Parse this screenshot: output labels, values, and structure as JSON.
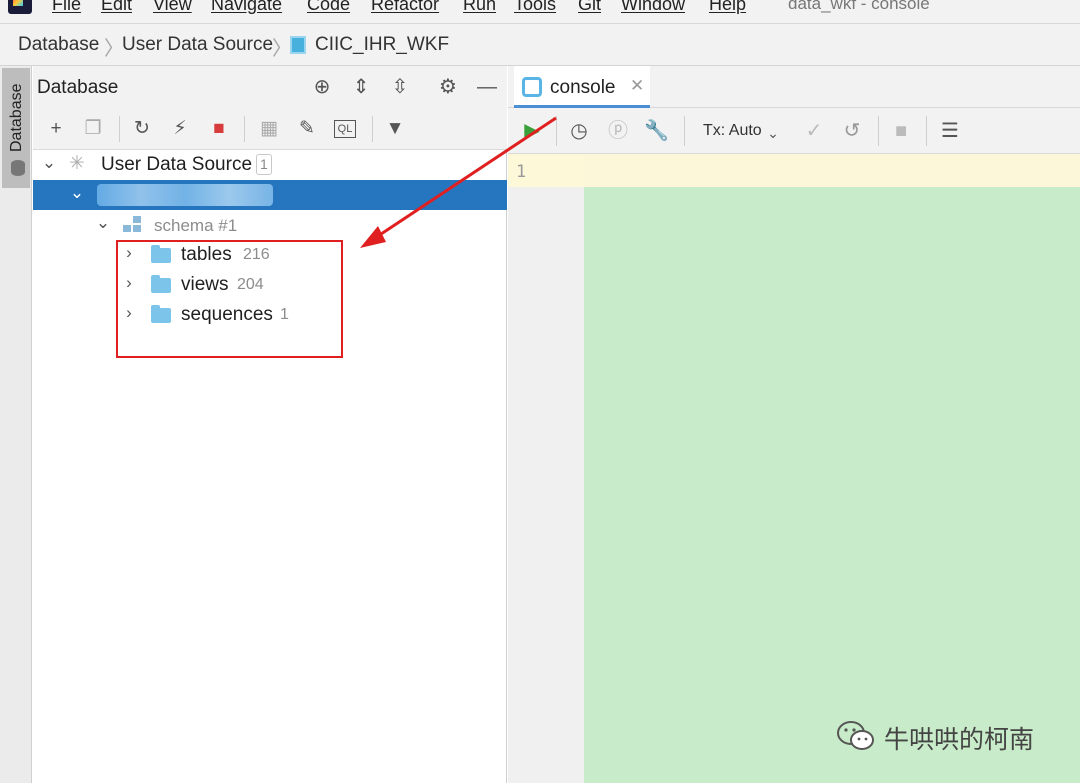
{
  "menu": {
    "items": [
      "File",
      "Edit",
      "View",
      "Navigate",
      "Code",
      "Refactor",
      "Run",
      "Tools",
      "Git",
      "Window",
      "Help"
    ],
    "window_title": "data_wkf - console"
  },
  "breadcrumb": {
    "items": [
      "Database",
      "User Data Source",
      "CIIC_IHR_WKF"
    ]
  },
  "side_stripe": {
    "label": "Database"
  },
  "db_panel": {
    "title": "Database",
    "header_icons": [
      "locate-icon",
      "expand-all-icon",
      "collapse-all-icon",
      "gear-icon",
      "minimize-icon"
    ],
    "toolbar_icons": [
      "add-icon",
      "duplicate-icon",
      "refresh-icon",
      "schema-sync-icon",
      "stop-icon",
      "table-view-icon",
      "edit-icon",
      "ql-console-icon",
      "filter-icon"
    ]
  },
  "tree": {
    "root": {
      "label": "User Data Source",
      "badge": "1"
    },
    "schema": {
      "label": "schema #1"
    },
    "folders": [
      {
        "label": "tables",
        "count": "216"
      },
      {
        "label": "views",
        "count": "204"
      },
      {
        "label": "sequences",
        "count": "1"
      }
    ]
  },
  "console": {
    "tab_label": "console",
    "tx_mode": "Tx: Auto",
    "line_number": "1",
    "toolbar_icons": [
      "run-icon",
      "history-icon",
      "parameters-icon",
      "settings-wrench-icon",
      "commit-icon",
      "rollback-icon",
      "stop-icon",
      "output-table-icon"
    ]
  },
  "watermark": {
    "text": "牛哄哄的柯南"
  },
  "colors": {
    "selection": "#2675bf",
    "annotation_red": "#e02020",
    "editor_bg": "#c8ecc9",
    "folder": "#7cc4ea"
  }
}
